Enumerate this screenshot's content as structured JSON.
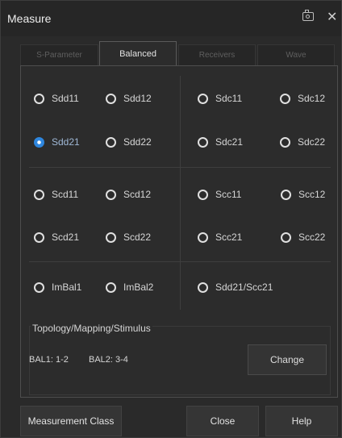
{
  "window": {
    "title": "Measure",
    "camera_icon": "camera-icon",
    "close_icon": "close-icon",
    "close_glyph": "✕"
  },
  "tabs": [
    {
      "label": "S-Parameter",
      "active": false
    },
    {
      "label": "Balanced",
      "active": true
    },
    {
      "label": "Receivers",
      "active": false
    },
    {
      "label": "Wave",
      "active": false
    }
  ],
  "params": {
    "sdd11": "Sdd11",
    "sdd12": "Sdd12",
    "sdc11": "Sdc11",
    "sdc12": "Sdc12",
    "sdd21": "Sdd21",
    "sdd22": "Sdd22",
    "sdc21": "Sdc21",
    "sdc22": "Sdc22",
    "scd11": "Scd11",
    "scd12": "Scd12",
    "scc11": "Scc11",
    "scc12": "Scc12",
    "scd21": "Scd21",
    "scd22": "Scd22",
    "scc21": "Scc21",
    "scc22": "Scc22",
    "imbal1": "ImBal1",
    "imbal2": "ImBal2",
    "sdd21_scc21": "Sdd21/Scc21"
  },
  "selected_param": "Sdd21",
  "topology": {
    "title": "Topology/Mapping/Stimulus",
    "bal1": "BAL1: 1-2",
    "bal2": "BAL2: 3-4",
    "change_label": "Change"
  },
  "footer": {
    "measurement_class_label": "Measurement Class",
    "close_label": "Close",
    "help_label": "Help"
  },
  "colors": {
    "background": "#2a2a2a",
    "selected_radio": "#2e86de"
  }
}
